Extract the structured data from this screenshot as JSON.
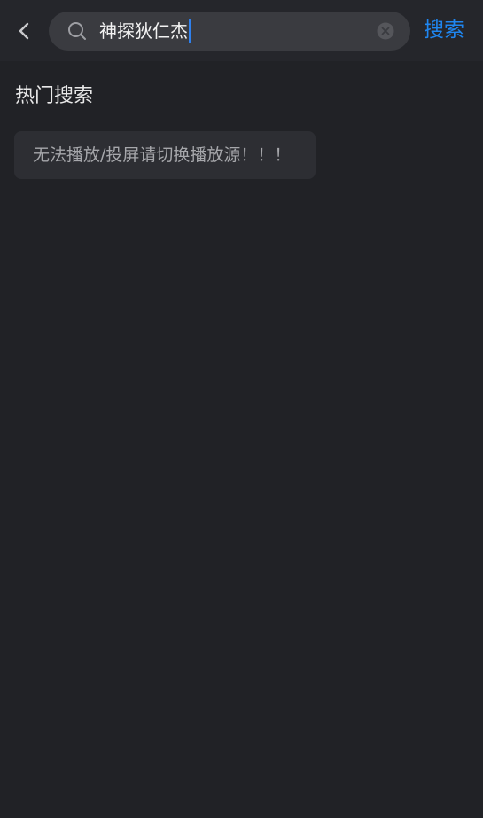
{
  "header": {
    "search_value": "神探狄仁杰",
    "search_button_label": "搜索",
    "icons": {
      "back": "chevron-left-icon",
      "search": "magnifier-icon",
      "clear": "clear-circle-x-icon"
    }
  },
  "hot_search": {
    "title": "热门搜索",
    "items": [
      {
        "label": "无法播放/投屏请切换播放源！！！"
      }
    ]
  },
  "colors": {
    "background": "#212226",
    "top_bar": "#25262b",
    "search_box": "#3a3b40",
    "accent": "#1f86f0",
    "tag_background": "#2d2e33",
    "tag_text": "#a6a7ab"
  }
}
